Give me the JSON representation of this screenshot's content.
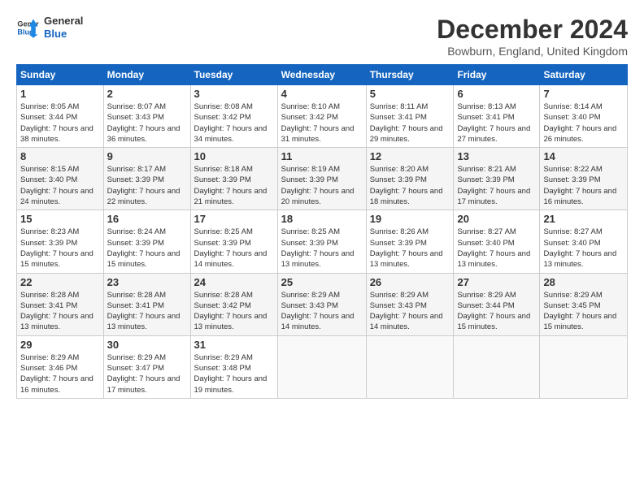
{
  "logo": {
    "line1": "General",
    "line2": "Blue"
  },
  "title": "December 2024",
  "subtitle": "Bowburn, England, United Kingdom",
  "days_header": [
    "Sunday",
    "Monday",
    "Tuesday",
    "Wednesday",
    "Thursday",
    "Friday",
    "Saturday"
  ],
  "weeks": [
    [
      {
        "num": "1",
        "sunrise": "8:05 AM",
        "sunset": "3:44 PM",
        "daylight": "7 hours and 38 minutes."
      },
      {
        "num": "2",
        "sunrise": "8:07 AM",
        "sunset": "3:43 PM",
        "daylight": "7 hours and 36 minutes."
      },
      {
        "num": "3",
        "sunrise": "8:08 AM",
        "sunset": "3:42 PM",
        "daylight": "7 hours and 34 minutes."
      },
      {
        "num": "4",
        "sunrise": "8:10 AM",
        "sunset": "3:42 PM",
        "daylight": "7 hours and 31 minutes."
      },
      {
        "num": "5",
        "sunrise": "8:11 AM",
        "sunset": "3:41 PM",
        "daylight": "7 hours and 29 minutes."
      },
      {
        "num": "6",
        "sunrise": "8:13 AM",
        "sunset": "3:41 PM",
        "daylight": "7 hours and 27 minutes."
      },
      {
        "num": "7",
        "sunrise": "8:14 AM",
        "sunset": "3:40 PM",
        "daylight": "7 hours and 26 minutes."
      }
    ],
    [
      {
        "num": "8",
        "sunrise": "8:15 AM",
        "sunset": "3:40 PM",
        "daylight": "7 hours and 24 minutes."
      },
      {
        "num": "9",
        "sunrise": "8:17 AM",
        "sunset": "3:39 PM",
        "daylight": "7 hours and 22 minutes."
      },
      {
        "num": "10",
        "sunrise": "8:18 AM",
        "sunset": "3:39 PM",
        "daylight": "7 hours and 21 minutes."
      },
      {
        "num": "11",
        "sunrise": "8:19 AM",
        "sunset": "3:39 PM",
        "daylight": "7 hours and 20 minutes."
      },
      {
        "num": "12",
        "sunrise": "8:20 AM",
        "sunset": "3:39 PM",
        "daylight": "7 hours and 18 minutes."
      },
      {
        "num": "13",
        "sunrise": "8:21 AM",
        "sunset": "3:39 PM",
        "daylight": "7 hours and 17 minutes."
      },
      {
        "num": "14",
        "sunrise": "8:22 AM",
        "sunset": "3:39 PM",
        "daylight": "7 hours and 16 minutes."
      }
    ],
    [
      {
        "num": "15",
        "sunrise": "8:23 AM",
        "sunset": "3:39 PM",
        "daylight": "7 hours and 15 minutes."
      },
      {
        "num": "16",
        "sunrise": "8:24 AM",
        "sunset": "3:39 PM",
        "daylight": "7 hours and 15 minutes."
      },
      {
        "num": "17",
        "sunrise": "8:25 AM",
        "sunset": "3:39 PM",
        "daylight": "7 hours and 14 minutes."
      },
      {
        "num": "18",
        "sunrise": "8:25 AM",
        "sunset": "3:39 PM",
        "daylight": "7 hours and 13 minutes."
      },
      {
        "num": "19",
        "sunrise": "8:26 AM",
        "sunset": "3:39 PM",
        "daylight": "7 hours and 13 minutes."
      },
      {
        "num": "20",
        "sunrise": "8:27 AM",
        "sunset": "3:40 PM",
        "daylight": "7 hours and 13 minutes."
      },
      {
        "num": "21",
        "sunrise": "8:27 AM",
        "sunset": "3:40 PM",
        "daylight": "7 hours and 13 minutes."
      }
    ],
    [
      {
        "num": "22",
        "sunrise": "8:28 AM",
        "sunset": "3:41 PM",
        "daylight": "7 hours and 13 minutes."
      },
      {
        "num": "23",
        "sunrise": "8:28 AM",
        "sunset": "3:41 PM",
        "daylight": "7 hours and 13 minutes."
      },
      {
        "num": "24",
        "sunrise": "8:28 AM",
        "sunset": "3:42 PM",
        "daylight": "7 hours and 13 minutes."
      },
      {
        "num": "25",
        "sunrise": "8:29 AM",
        "sunset": "3:43 PM",
        "daylight": "7 hours and 14 minutes."
      },
      {
        "num": "26",
        "sunrise": "8:29 AM",
        "sunset": "3:43 PM",
        "daylight": "7 hours and 14 minutes."
      },
      {
        "num": "27",
        "sunrise": "8:29 AM",
        "sunset": "3:44 PM",
        "daylight": "7 hours and 15 minutes."
      },
      {
        "num": "28",
        "sunrise": "8:29 AM",
        "sunset": "3:45 PM",
        "daylight": "7 hours and 15 minutes."
      }
    ],
    [
      {
        "num": "29",
        "sunrise": "8:29 AM",
        "sunset": "3:46 PM",
        "daylight": "7 hours and 16 minutes."
      },
      {
        "num": "30",
        "sunrise": "8:29 AM",
        "sunset": "3:47 PM",
        "daylight": "7 hours and 17 minutes."
      },
      {
        "num": "31",
        "sunrise": "8:29 AM",
        "sunset": "3:48 PM",
        "daylight": "7 hours and 19 minutes."
      },
      null,
      null,
      null,
      null
    ]
  ]
}
